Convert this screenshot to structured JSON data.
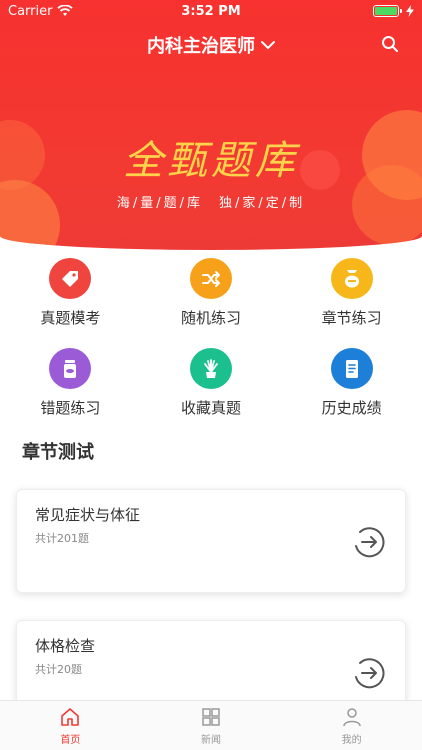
{
  "status_bar": {
    "carrier": "Carrier",
    "time": "3:52 PM"
  },
  "header": {
    "title": "内科主治医师"
  },
  "banner": {
    "title": "全甄题库",
    "subtitle": "海/量/题/库　独/家/定/制"
  },
  "features": [
    {
      "label": "真题模考",
      "color": "#f0443e"
    },
    {
      "label": "随机练习",
      "color": "#f7a11a"
    },
    {
      "label": "章节练习",
      "color": "#f7b71a"
    },
    {
      "label": "错题练习",
      "color": "#9b5bd6"
    },
    {
      "label": "收藏真题",
      "color": "#1cbf8e"
    },
    {
      "label": "历史成绩",
      "color": "#1e7fd8"
    }
  ],
  "section": {
    "title": "章节测试"
  },
  "cards": [
    {
      "title": "常见症状与体征",
      "count": "共计201题"
    },
    {
      "title": "体格检查",
      "count": "共计20题"
    }
  ],
  "tabs": [
    {
      "label": "首页"
    },
    {
      "label": "新闻"
    },
    {
      "label": "我的"
    }
  ],
  "colors": {
    "accent": "#f23a32",
    "brand_gold": "#ffd34a"
  }
}
